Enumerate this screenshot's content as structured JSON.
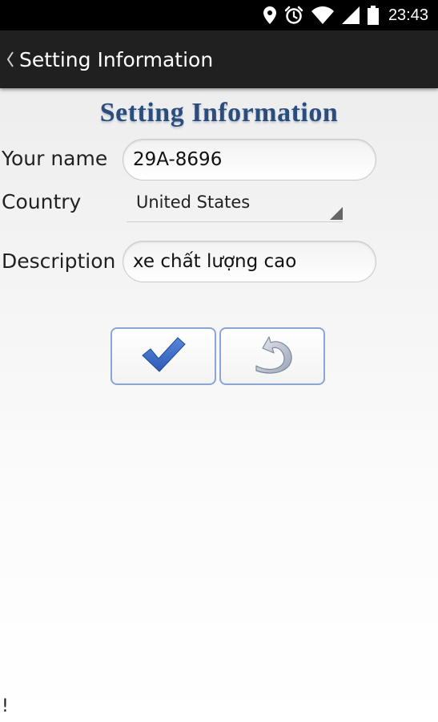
{
  "status_bar": {
    "time": "23:43",
    "icons": [
      "location-icon",
      "alarm-icon",
      "wifi-icon",
      "signal-icon",
      "battery-icon"
    ]
  },
  "action_bar": {
    "title": "Setting Information",
    "back_icon": "chevron-left-icon"
  },
  "header": {
    "title": "Setting Information",
    "title_color": "#2b4d7e"
  },
  "form": {
    "name_label": "Your name",
    "name_value": "29A-8696",
    "country_label": "Country",
    "country_value": "United States",
    "description_label": "Description",
    "description_value": "xe chất lượng cao"
  },
  "buttons": {
    "confirm_icon": "checkmark-icon",
    "back_icon": "undo-arrow-icon",
    "border_color": "#8aa6d6"
  },
  "footer": {
    "mark": "!"
  }
}
